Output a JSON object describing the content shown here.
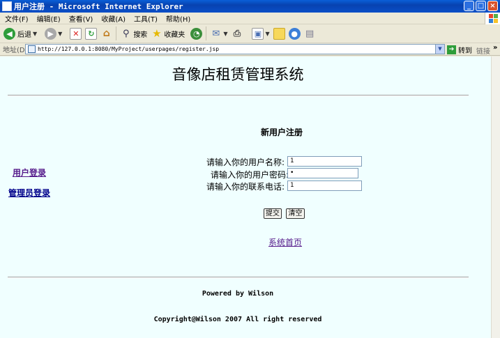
{
  "window": {
    "title": "用户注册 - Microsoft Internet Explorer",
    "controls": {
      "minimize": "_",
      "maximize": "□",
      "close": "×"
    }
  },
  "menu": [
    "文件(F)",
    "编辑(E)",
    "查看(V)",
    "收藏(A)",
    "工具(T)",
    "帮助(H)"
  ],
  "toolbar": {
    "back_label": "后退",
    "search_label": "搜索",
    "favorites_label": "收藏夹",
    "icons": [
      "back-icon",
      "forward-icon",
      "stop-icon",
      "refresh-icon",
      "home-icon",
      "search-icon",
      "favorites-icon",
      "history-icon",
      "mail-icon",
      "print-icon",
      "edit-icon",
      "messenger-icon",
      "mac-icon",
      "research-icon"
    ]
  },
  "address": {
    "label": "地址(D)",
    "url": "http://127.0.0.1:8080/MyProject/userpages/register.jsp",
    "go_label": "转到",
    "links_label": "链接",
    "more": "»"
  },
  "page": {
    "title": "音像店租赁管理系统",
    "sidebar": {
      "user_login": "用户登录",
      "admin_login": "管理员登录"
    },
    "form": {
      "heading": "新用户注册",
      "username_label": "请输入你的用户名称:",
      "username_value": "1",
      "password_label": "请输入你的用户密码:",
      "password_value": "•",
      "phone_label": "请输入你的联系电话:",
      "phone_value": "1",
      "submit_label": "提交",
      "reset_label": "清空"
    },
    "home_link": "系统首页",
    "footer": {
      "powered": "Powered by Wilson",
      "copyright": "Copyright@Wilson 2007 All right reserved"
    }
  }
}
